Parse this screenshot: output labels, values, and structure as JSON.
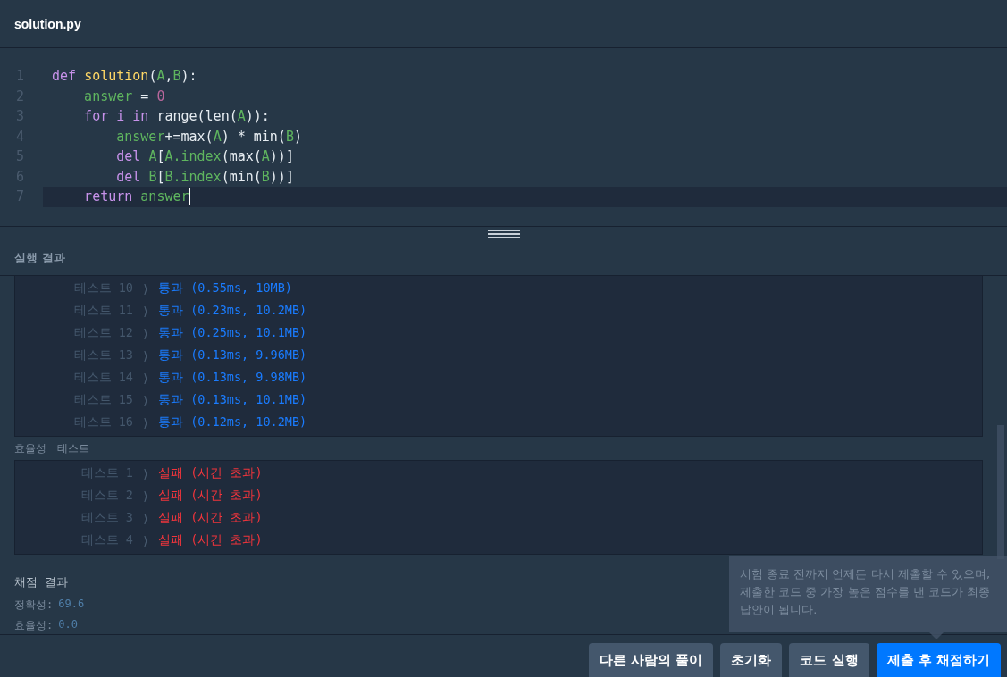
{
  "file_tab": {
    "title": "solution.py"
  },
  "editor": {
    "lines": [
      {
        "number": "1",
        "current": false,
        "tokens": [
          {
            "t": "def ",
            "kind": "kw"
          },
          {
            "t": "solution",
            "kind": "fn"
          },
          {
            "t": "(",
            "kind": "plain"
          },
          {
            "t": "A",
            "kind": "var"
          },
          {
            "t": ",",
            "kind": "plain"
          },
          {
            "t": "B",
            "kind": "var"
          },
          {
            "t": "):",
            "kind": "plain"
          }
        ]
      },
      {
        "number": "2",
        "current": false,
        "tokens": [
          {
            "t": "    answer",
            "kind": "var"
          },
          {
            "t": " = ",
            "kind": "plain"
          },
          {
            "t": "0",
            "kind": "num"
          }
        ]
      },
      {
        "number": "3",
        "current": false,
        "tokens": [
          {
            "t": "    for i in ",
            "kind": "kw"
          },
          {
            "t": "range(len(",
            "kind": "plain"
          },
          {
            "t": "A",
            "kind": "var"
          },
          {
            "t": ")):",
            "kind": "plain"
          }
        ]
      },
      {
        "number": "4",
        "current": false,
        "tokens": [
          {
            "t": "        answer",
            "kind": "var"
          },
          {
            "t": "+=max(",
            "kind": "plain"
          },
          {
            "t": "A",
            "kind": "var"
          },
          {
            "t": ") * min(",
            "kind": "plain"
          },
          {
            "t": "B",
            "kind": "var"
          },
          {
            "t": ")",
            "kind": "plain"
          }
        ]
      },
      {
        "number": "5",
        "current": false,
        "tokens": [
          {
            "t": "        del ",
            "kind": "kw"
          },
          {
            "t": "A",
            "kind": "var"
          },
          {
            "t": "[",
            "kind": "plain"
          },
          {
            "t": "A.index",
            "kind": "var"
          },
          {
            "t": "(max(",
            "kind": "plain"
          },
          {
            "t": "A",
            "kind": "var"
          },
          {
            "t": "))]",
            "kind": "plain"
          }
        ]
      },
      {
        "number": "6",
        "current": false,
        "tokens": [
          {
            "t": "        del ",
            "kind": "kw"
          },
          {
            "t": "B",
            "kind": "var"
          },
          {
            "t": "[",
            "kind": "plain"
          },
          {
            "t": "B.index",
            "kind": "var"
          },
          {
            "t": "(min(",
            "kind": "plain"
          },
          {
            "t": "B",
            "kind": "var"
          },
          {
            "t": "))]",
            "kind": "plain"
          }
        ]
      },
      {
        "number": "7",
        "current": true,
        "tokens": [
          {
            "t": "    return ",
            "kind": "kw"
          },
          {
            "t": "answer",
            "kind": "var"
          }
        ]
      }
    ]
  },
  "results_panel": {
    "title": "실행 결과",
    "accuracy_tests": [
      {
        "label": "테스트 10",
        "arrow": "⟩",
        "result": "통과 (0.55ms, 10MB)",
        "passed": true
      },
      {
        "label": "테스트 11",
        "arrow": "⟩",
        "result": "통과 (0.23ms, 10.2MB)",
        "passed": true
      },
      {
        "label": "테스트 12",
        "arrow": "⟩",
        "result": "통과 (0.25ms, 10.1MB)",
        "passed": true
      },
      {
        "label": "테스트 13",
        "arrow": "⟩",
        "result": "통과 (0.13ms, 9.96MB)",
        "passed": true
      },
      {
        "label": "테스트 14",
        "arrow": "⟩",
        "result": "통과 (0.13ms, 9.98MB)",
        "passed": true
      },
      {
        "label": "테스트 15",
        "arrow": "⟩",
        "result": "통과 (0.13ms, 10.1MB)",
        "passed": true
      },
      {
        "label": "테스트 16",
        "arrow": "⟩",
        "result": "통과 (0.12ms, 10.2MB)",
        "passed": true
      }
    ],
    "efficiency_heading": [
      "효율성",
      "테스트"
    ],
    "efficiency_tests": [
      {
        "label": "테스트 1",
        "arrow": "⟩",
        "result": "실패 (시간 초과)",
        "passed": false
      },
      {
        "label": "테스트 2",
        "arrow": "⟩",
        "result": "실패 (시간 초과)",
        "passed": false
      },
      {
        "label": "테스트 3",
        "arrow": "⟩",
        "result": "실패 (시간 초과)",
        "passed": false
      },
      {
        "label": "테스트 4",
        "arrow": "⟩",
        "result": "실패 (시간 초과)",
        "passed": false
      }
    ],
    "grading": {
      "title": "채점 결과",
      "scores": [
        {
          "label": "정확성:",
          "value": "69.6"
        },
        {
          "label": "효율성:",
          "value": "0.0"
        }
      ]
    }
  },
  "tooltip": {
    "text": "시험 종료 전까지 언제든 다시 제출할 수 있으며, 제출한 코드 중 가장 높은 점수를 낸 코드가 최종 답안이 됩니다."
  },
  "buttons": [
    {
      "label": "다른 사람의 풀이",
      "kind": "secondary"
    },
    {
      "label": "초기화",
      "kind": "secondary"
    },
    {
      "label": "코드 실행",
      "kind": "secondary"
    },
    {
      "label": "제출 후 채점하기",
      "kind": "primary"
    }
  ]
}
